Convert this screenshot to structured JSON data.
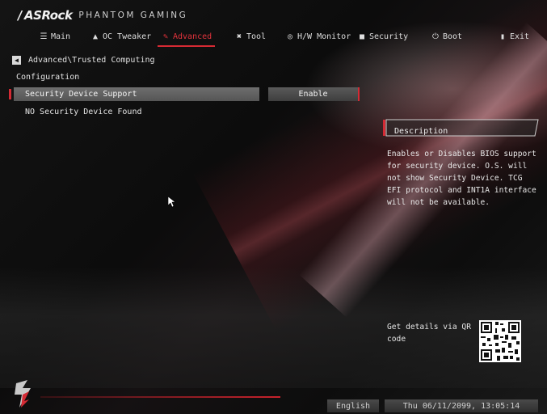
{
  "brand": {
    "name": "ASRock",
    "subtitle": "PHANTOM GAMING"
  },
  "tabs": [
    {
      "label": "Main",
      "icon": "list-icon",
      "active": false
    },
    {
      "label": "OC Tweaker",
      "icon": "flask-icon",
      "active": false
    },
    {
      "label": "Advanced",
      "icon": "advanced-icon",
      "active": true
    },
    {
      "label": "Tool",
      "icon": "tool-icon",
      "active": false
    },
    {
      "label": "H/W Monitor",
      "icon": "monitor-icon",
      "active": false
    },
    {
      "label": "Security",
      "icon": "shield-icon",
      "active": false
    },
    {
      "label": "Boot",
      "icon": "power-icon",
      "active": false
    },
    {
      "label": "Exit",
      "icon": "exit-icon",
      "active": false
    }
  ],
  "breadcrumb": "Advanced\\Trusted Computing",
  "section_label": "Configuration",
  "setting": {
    "label": "Security Device Support",
    "value": "Enable"
  },
  "info_line": "NO Security Device Found",
  "description": {
    "title": "Description",
    "body": "Enables or Disables BIOS support for security device. O.S. will not show Security Device. TCG EFI protocol and INT1A interface will not be available."
  },
  "qr_text": "Get details via QR code",
  "footer": {
    "language": "English",
    "datetime": "Thu 06/11/2099, 13:05:14"
  },
  "colors": {
    "accent": "#d42a34",
    "background": "#0a0a0a"
  }
}
